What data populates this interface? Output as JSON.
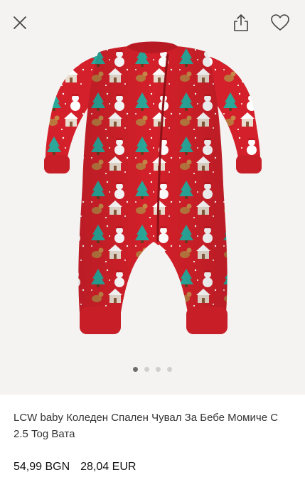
{
  "header": {
    "close_icon": "close-icon",
    "share_icon": "share-icon",
    "favorite_icon": "heart-icon"
  },
  "gallery": {
    "image_count": 4,
    "active_index": 0,
    "garment_color": "#d4202a",
    "background_color": "#f4f3f1"
  },
  "product": {
    "title": "LCW baby Коледен Спален Чувал За Бебе Момиче С 2.5 Tog Вата",
    "price_bgn": "54,99 BGN",
    "price_eur": "28,04 EUR"
  }
}
